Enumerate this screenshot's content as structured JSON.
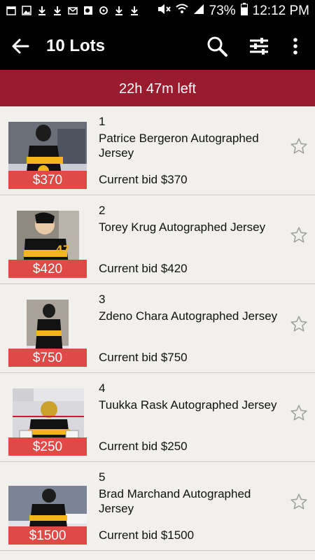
{
  "status": {
    "battery": "73%",
    "time": "12:12 PM"
  },
  "appbar": {
    "title": "10 Lots"
  },
  "timer": {
    "text": "22h 47m  left"
  },
  "bid_prefix": "Current bid ",
  "lots": [
    {
      "number": "1",
      "name": "Patrice Bergeron Autographed Jersey",
      "price": "$370",
      "bid": "Current bid $370"
    },
    {
      "number": "2",
      "name": "Torey Krug Autographed Jersey",
      "price": "$420",
      "bid": "Current bid $420"
    },
    {
      "number": "3",
      "name": "Zdeno Chara Autographed Jersey",
      "price": "$750",
      "bid": "Current bid $750"
    },
    {
      "number": "4",
      "name": "Tuukka Rask Autographed Jersey",
      "price": "$250",
      "bid": "Current bid $250"
    },
    {
      "number": "5",
      "name": "Brad Marchand Autographed Jersey",
      "price": "$1500",
      "bid": "Current bid $1500"
    }
  ]
}
